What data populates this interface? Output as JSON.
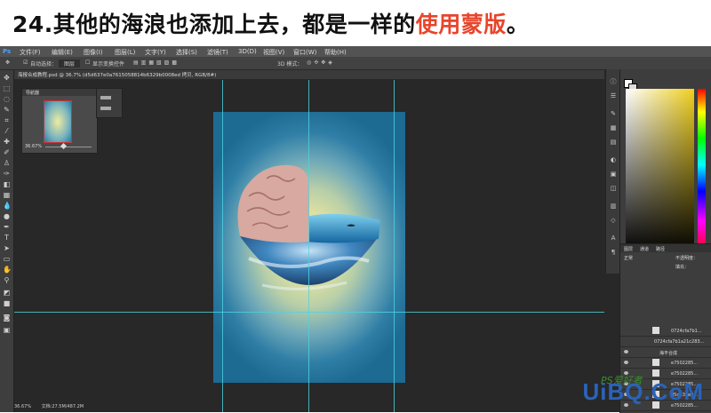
{
  "banner": {
    "prefix": "24.其他的海浪也添加上去，都是一样的",
    "highlight": "使用蒙版",
    "suffix": "。",
    "highlight_color": "#e8452c"
  },
  "app": {
    "logo": "Ps",
    "menu": [
      "文件(F)",
      "编辑(E)",
      "图像(I)",
      "图层(L)",
      "文字(Y)",
      "选择(S)",
      "滤镜(T)",
      "3D(D)",
      "视图(V)",
      "窗口(W)",
      "帮助(H)"
    ],
    "options": {
      "auto_select": "自动选择：",
      "auto_select_value": "图层",
      "show_transform": "显示变换控件",
      "mode_3d": "3D 模式："
    },
    "doc_tab": "海报合成教程.psd @ 36.7% (d5d637e0a7615058814b6329b0008ed 拷贝, RGB/8#)",
    "status_zoom": "36.67%",
    "status_doc": "文档:27.5M/487.2M"
  },
  "navigator": {
    "title": "导航器",
    "zoom": "36.67%"
  },
  "layers": {
    "tabs": [
      "图层",
      "通道",
      "路径"
    ],
    "blend_mode": "正常",
    "opacity_label": "不透明度：",
    "fill_label": "填充：",
    "rows": [
      {
        "label": "0724cfa7b1...",
        "visible": false
      },
      {
        "label": "0724cfa7b1a21c283...",
        "visible": false
      },
      {
        "label": "海平合成",
        "visible": true,
        "group": true
      },
      {
        "label": "e7502285...",
        "visible": true
      },
      {
        "label": "e7502285...",
        "visible": true
      },
      {
        "label": "e7502285...",
        "visible": true
      },
      {
        "label": "d5d637e0...",
        "visible": true
      },
      {
        "label": "e7502285...",
        "visible": true
      }
    ]
  },
  "watermark": {
    "text": "UiBQ.CoM",
    "sub": "PS爱好者"
  }
}
